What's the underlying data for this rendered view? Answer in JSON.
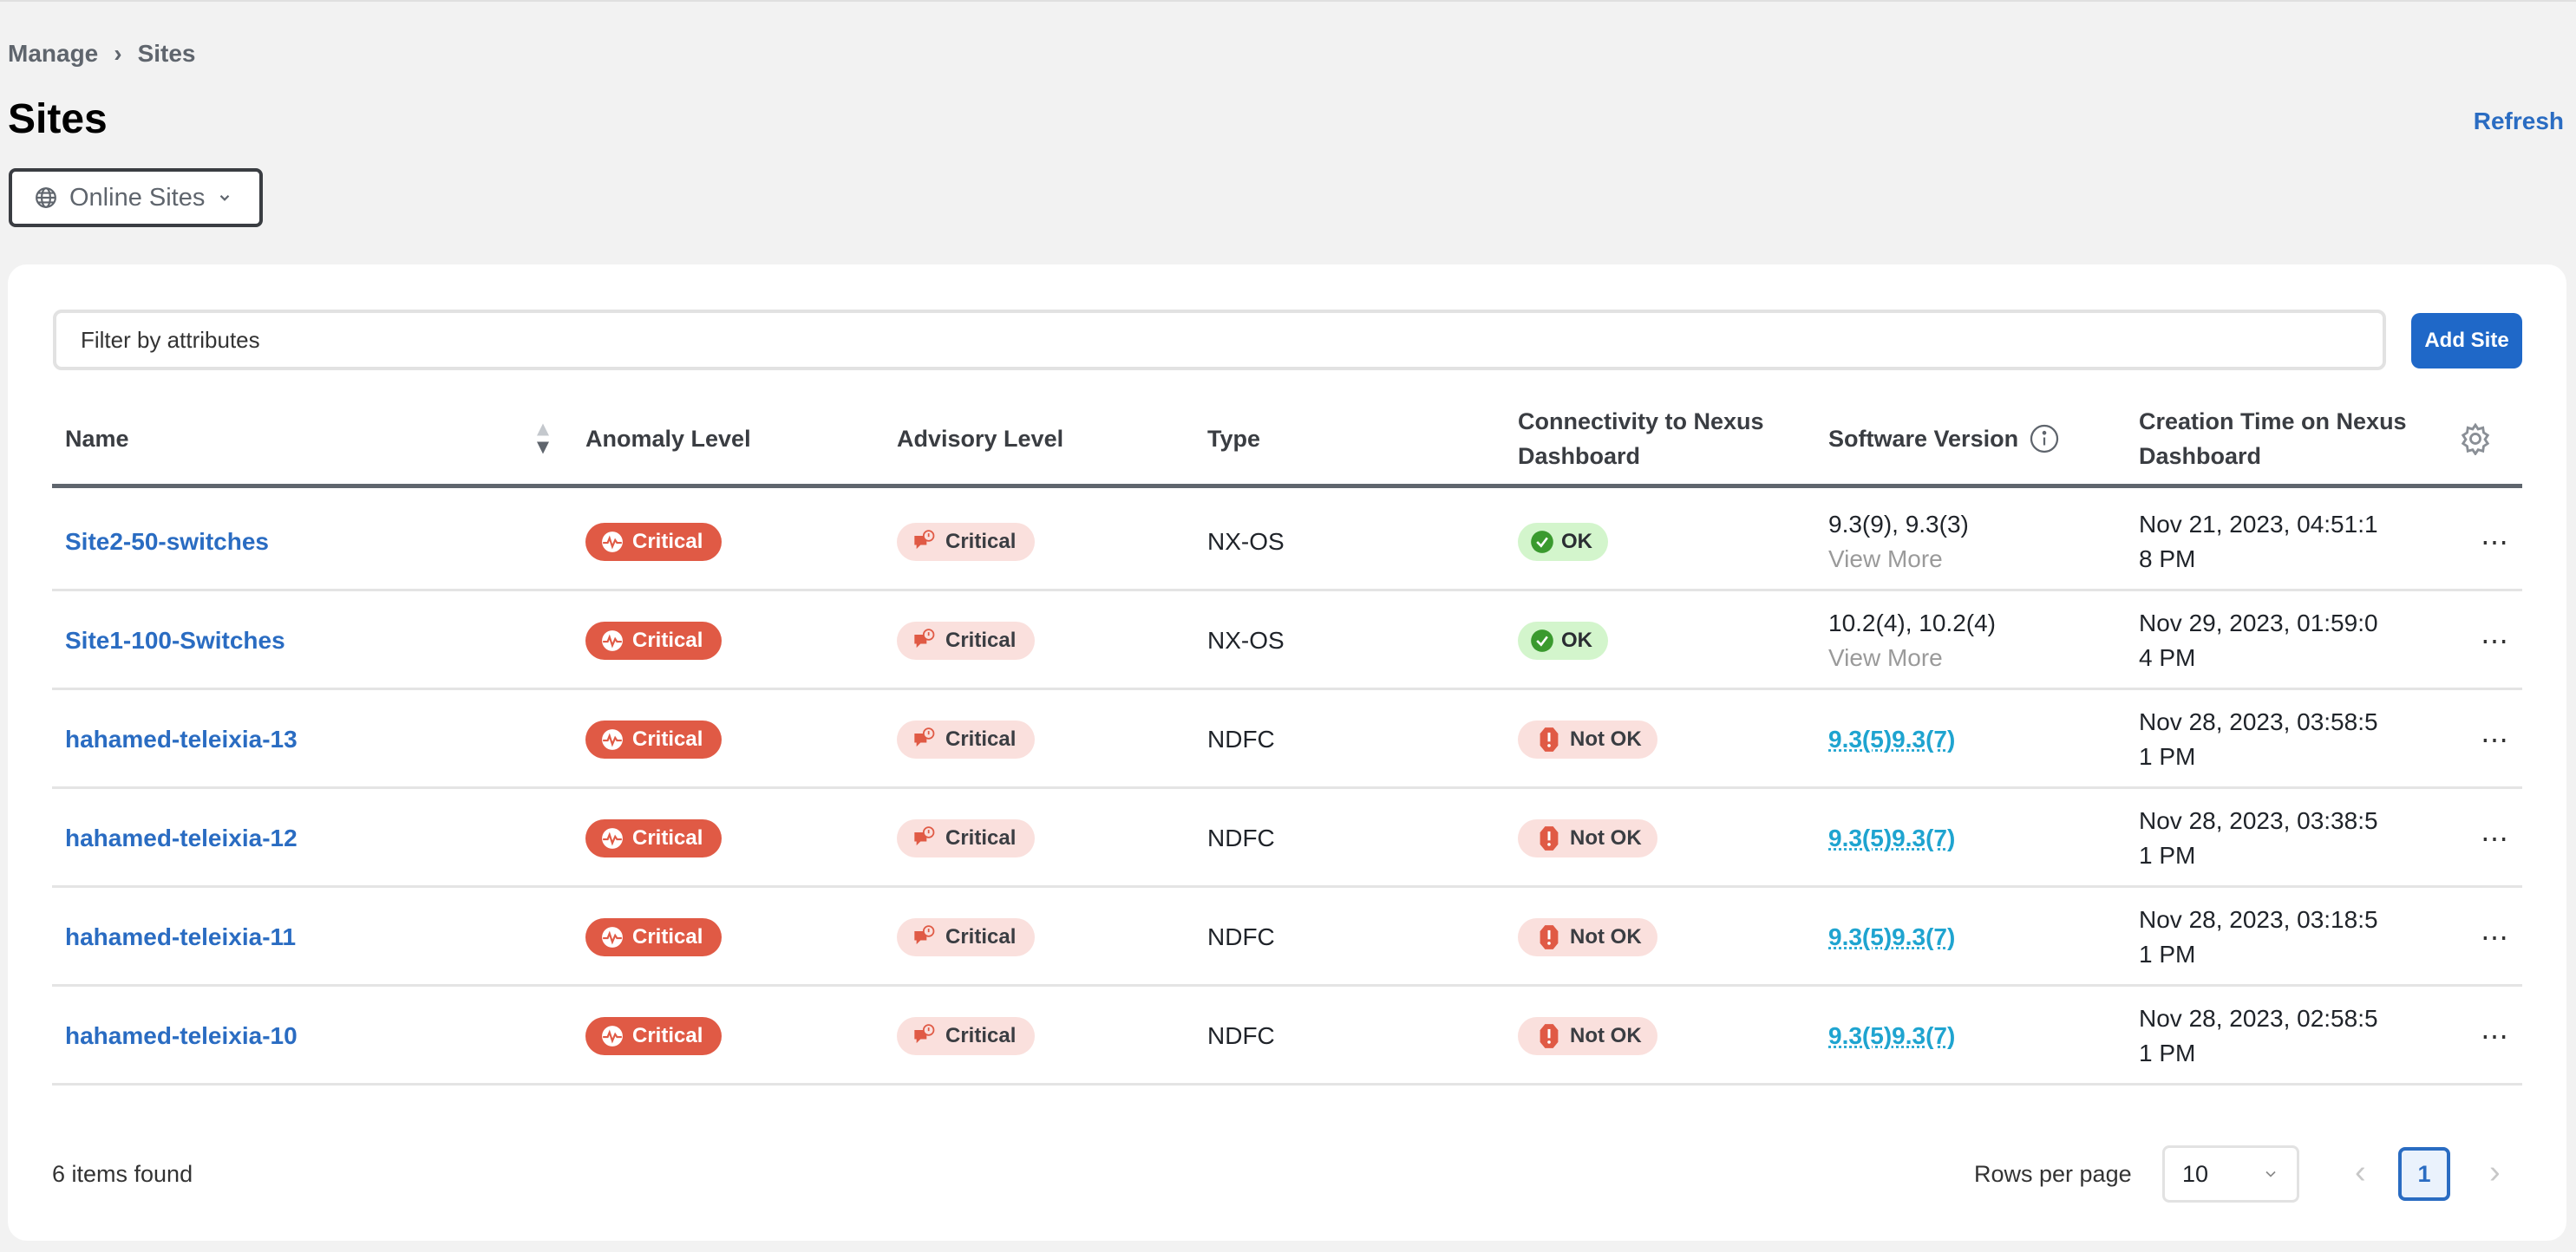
{
  "breadcrumb": {
    "parent": "Manage",
    "separator": "›",
    "current": "Sites"
  },
  "page_title": "Sites",
  "refresh_label": "Refresh",
  "site_filter": {
    "icon": "globe-icon",
    "label": "Online Sites"
  },
  "filter": {
    "placeholder": "Filter by attributes",
    "value": ""
  },
  "add_site_label": "Add Site",
  "columns": {
    "name": "Name",
    "anomaly": "Anomaly Level",
    "advisory": "Advisory Level",
    "type": "Type",
    "connectivity": "Connectivity to Nexus Dashboard",
    "software": "Software Version",
    "creation": "Creation Time on Nexus Dashboard"
  },
  "rows": [
    {
      "name": "Site2-50-switches",
      "anomaly": "Critical",
      "advisory": "Critical",
      "type": "NX-OS",
      "connectivity": "OK",
      "software": "9.3(9), 9.3(3)",
      "software_more": "View More",
      "creation1": "Nov 21, 2023, 04:51:1",
      "creation2": "8 PM"
    },
    {
      "name": "Site1-100-Switches",
      "anomaly": "Critical",
      "advisory": "Critical",
      "type": "NX-OS",
      "connectivity": "OK",
      "software": "10.2(4), 10.2(4)",
      "software_more": "View More",
      "creation1": "Nov 29, 2023, 01:59:0",
      "creation2": "4 PM"
    },
    {
      "name": "hahamed-teleixia-13",
      "anomaly": "Critical",
      "advisory": "Critical",
      "type": "NDFC",
      "connectivity": "Not OK",
      "software": "9.3(5)9.3(7)",
      "creation1": "Nov 28, 2023, 03:58:5",
      "creation2": "1 PM"
    },
    {
      "name": "hahamed-teleixia-12",
      "anomaly": "Critical",
      "advisory": "Critical",
      "type": "NDFC",
      "connectivity": "Not OK",
      "software": "9.3(5)9.3(7)",
      "creation1": "Nov 28, 2023, 03:38:5",
      "creation2": "1 PM"
    },
    {
      "name": "hahamed-teleixia-11",
      "anomaly": "Critical",
      "advisory": "Critical",
      "type": "NDFC",
      "connectivity": "Not OK",
      "software": "9.3(5)9.3(7)",
      "creation1": "Nov 28, 2023, 03:18:5",
      "creation2": "1 PM"
    },
    {
      "name": "hahamed-teleixia-10",
      "anomaly": "Critical",
      "advisory": "Critical",
      "type": "NDFC",
      "connectivity": "Not OK",
      "software": "9.3(5)9.3(7)",
      "creation1": "Nov 28, 2023, 02:58:5",
      "creation2": "1 PM"
    }
  ],
  "footer": {
    "items_found": "6 items found",
    "rows_per_page_label": "Rows per page",
    "rows_per_page": "10",
    "current_page": "1"
  },
  "colors": {
    "accent": "#1f68c8",
    "critical": "#e05a45",
    "ok": "#3a9a2e",
    "link": "#2a6cc2"
  }
}
